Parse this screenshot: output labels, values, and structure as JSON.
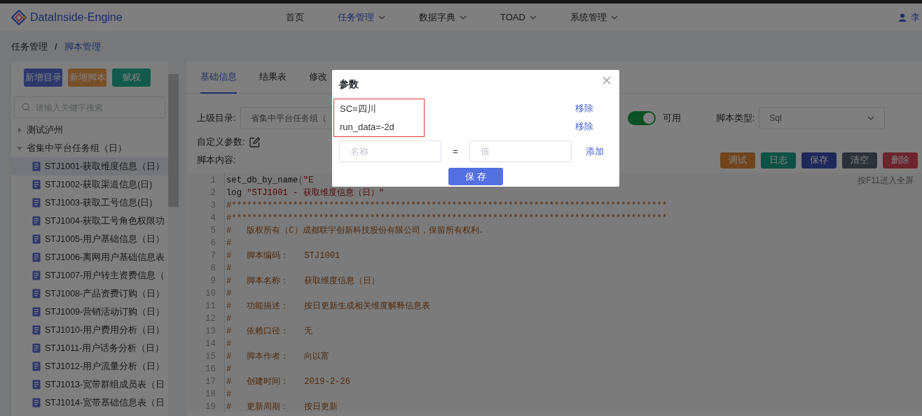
{
  "navbar": {
    "brand": "DataInside-Engine",
    "menu": [
      {
        "label": "首页",
        "selected": false,
        "dropdown": false
      },
      {
        "label": "任务管理",
        "selected": true,
        "dropdown": true
      },
      {
        "label": "数据字典",
        "selected": false,
        "dropdown": true
      },
      {
        "label": "TOAD",
        "selected": false,
        "dropdown": true
      },
      {
        "label": "系统管理",
        "selected": false,
        "dropdown": true
      }
    ],
    "user": "李"
  },
  "breadcrumb": {
    "separator": "/",
    "items": [
      {
        "label": "任务管理",
        "selected": false
      },
      {
        "label": "脚本管理",
        "selected": true
      }
    ]
  },
  "sidebar": {
    "buttons": [
      {
        "label": "新增目录",
        "kind": "primary"
      },
      {
        "label": "新增脚本",
        "kind": "warning"
      },
      {
        "label": "赋权",
        "kind": "success"
      }
    ],
    "search": {
      "placeholder": "请输入关键字搜索"
    },
    "tree": [
      {
        "label": "测试泸州",
        "expanded": false
      },
      {
        "label": "省集中平台任务组（日）",
        "expanded": true,
        "children": [
          {
            "label": "STJ1001-获取维度信息（日）",
            "selected": true
          },
          {
            "label": "STJ1002-获取渠道信息(日)",
            "selected": false
          },
          {
            "label": "STJ1003-获取工号信息(日)",
            "selected": false
          },
          {
            "label": "STJ1004-获取工号角色权限功",
            "selected": false
          },
          {
            "label": "STJ1005-用户基础信息（日）",
            "selected": false
          },
          {
            "label": "STJ1006-离网用户基础信息表",
            "selected": false
          },
          {
            "label": "STJ1007-用户转主资费信息（",
            "selected": false
          },
          {
            "label": "STJ1008-产品资费订购（日）",
            "selected": false
          },
          {
            "label": "STJ1009-营销活动订购（日）",
            "selected": false
          },
          {
            "label": "STJ1010-用户费用分析（日）",
            "selected": false
          },
          {
            "label": "STJ1011-用户话务分析（日）",
            "selected": false
          },
          {
            "label": "STJ1012-用户流量分析（日）",
            "selected": false
          },
          {
            "label": "STJ1013-宽带群组成员表（日",
            "selected": false
          },
          {
            "label": "STJ1014-宽带基础信息表（日",
            "selected": false
          }
        ]
      }
    ]
  },
  "tabs": [
    {
      "label": "基础信息",
      "selected": true
    },
    {
      "label": "结果表",
      "selected": false
    },
    {
      "label": "修改",
      "selected": false
    }
  ],
  "form": {
    "parent_dir_label": "上级目录:",
    "parent_dir_value": "省集中平台任务组（",
    "enabled": {
      "on": true,
      "label": "可用"
    },
    "script_type_label": "脚本类型:",
    "script_type_value": "Sql",
    "custom_params_label": "自定义参数:",
    "content_label": "脚本内容:"
  },
  "actions": [
    {
      "label": "调试",
      "kind": "debug"
    },
    {
      "label": "日志",
      "kind": "log"
    },
    {
      "label": "保存",
      "kind": "save"
    },
    {
      "label": "清空",
      "kind": "clear"
    },
    {
      "label": "删除",
      "kind": "delete"
    }
  ],
  "editor": {
    "hint": "按F11进入全屏",
    "lines": [
      {
        "number": "1",
        "segments": [
          {
            "text": "set_db_by_name",
            "kind": "plain"
          },
          {
            "text": "(",
            "kind": "punct"
          },
          {
            "text": "\"E",
            "kind": "string"
          }
        ]
      },
      {
        "number": "2",
        "segments": [
          {
            "text": "log ",
            "kind": "plain"
          },
          {
            "text": "\"STJ1001 - 获取维度信息（日）\"",
            "kind": "string"
          }
        ]
      },
      {
        "number": "3",
        "segments": [
          {
            "text": "#*************************************************************************************",
            "kind": "comment"
          }
        ]
      },
      {
        "number": "4",
        "segments": [
          {
            "text": "#*************************************************************************************",
            "kind": "comment"
          }
        ]
      },
      {
        "number": "5",
        "segments": [
          {
            "text": "#   版权所有（C）成都联宇创新科技股份有限公司，保留所有权利.",
            "kind": "comment"
          }
        ]
      },
      {
        "number": "6",
        "segments": [
          {
            "text": "#",
            "kind": "comment"
          }
        ]
      },
      {
        "number": "7",
        "segments": [
          {
            "text": "#   脚本编码：   STJ1001",
            "kind": "comment"
          }
        ]
      },
      {
        "number": "8",
        "segments": [
          {
            "text": "#",
            "kind": "comment"
          }
        ]
      },
      {
        "number": "9",
        "segments": [
          {
            "text": "#   脚本名称：   获取维度信息（日）",
            "kind": "comment"
          }
        ]
      },
      {
        "number": "10",
        "segments": [
          {
            "text": "#",
            "kind": "comment"
          }
        ]
      },
      {
        "number": "11",
        "segments": [
          {
            "text": "#   功能描述：   按日更新生成相关维度解释信息表",
            "kind": "comment"
          }
        ]
      },
      {
        "number": "12",
        "segments": [
          {
            "text": "#",
            "kind": "comment"
          }
        ]
      },
      {
        "number": "13",
        "segments": [
          {
            "text": "#   依赖口径：   无",
            "kind": "comment"
          }
        ]
      },
      {
        "number": "14",
        "segments": [
          {
            "text": "#",
            "kind": "comment"
          }
        ]
      },
      {
        "number": "15",
        "segments": [
          {
            "text": "#   脚本作者：   向以富",
            "kind": "comment"
          }
        ]
      },
      {
        "number": "16",
        "segments": [
          {
            "text": "#",
            "kind": "comment"
          }
        ]
      },
      {
        "number": "17",
        "segments": [
          {
            "text": "#   创建时间：   2019-2-26",
            "kind": "comment"
          }
        ]
      },
      {
        "number": "18",
        "segments": [
          {
            "text": "#",
            "kind": "comment"
          }
        ]
      },
      {
        "number": "19",
        "segments": [
          {
            "text": "#   更新周期：   按日更新",
            "kind": "comment"
          }
        ]
      }
    ]
  },
  "dialog": {
    "title": "参数",
    "params_highlighted": true,
    "params": [
      {
        "text": "SC=四川",
        "action": "移除"
      },
      {
        "text": "run_data=-2d",
        "action": "移除"
      }
    ],
    "name_placeholder": "名称",
    "equals": "=",
    "value_placeholder": "值",
    "add": "添加",
    "save": "保 存"
  }
}
